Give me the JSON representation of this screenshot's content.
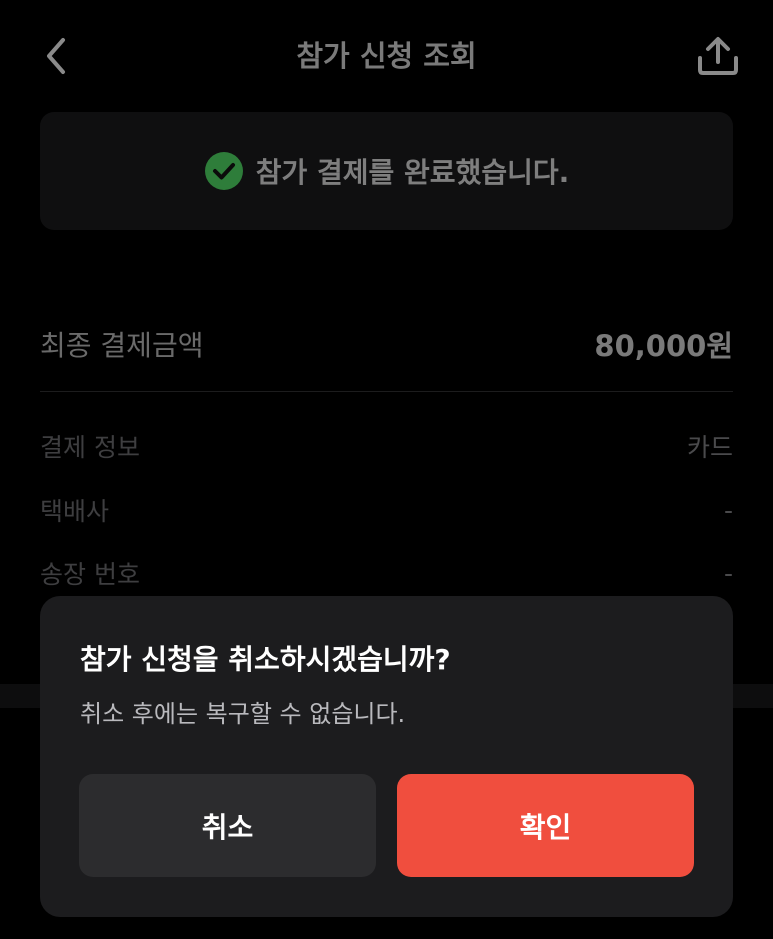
{
  "header": {
    "title": "참가 신청 조회",
    "back_icon": "chevron-left-icon",
    "share_icon": "share-upload-icon"
  },
  "banner": {
    "icon": "check-circle-icon",
    "text": "참가 결제를 완료했습니다.",
    "icon_color": "#34a853"
  },
  "summary": {
    "total_label": "최종 결제금액",
    "total_value": "80,000원"
  },
  "details": [
    {
      "label": "결제 정보",
      "value": "카드"
    },
    {
      "label": "택배사",
      "value": "-"
    },
    {
      "label": "송장 번호",
      "value": "-"
    }
  ],
  "dialog": {
    "title": "참가 신청을 취소하시겠습니까?",
    "message": "취소 후에는 복구할 수 없습니다.",
    "cancel_label": "취소",
    "confirm_label": "확인",
    "confirm_color": "#f04e3e"
  }
}
